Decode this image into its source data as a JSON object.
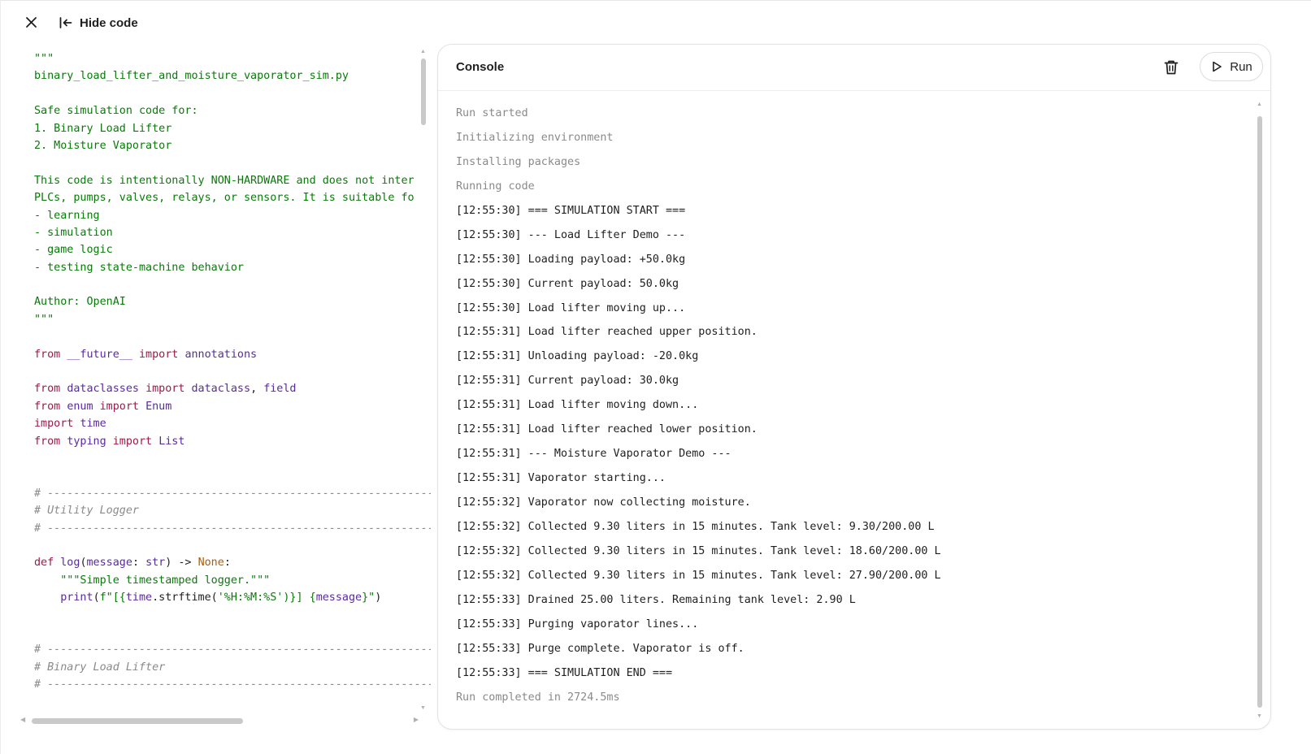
{
  "toolbar": {
    "hide_code_label": "Hide code"
  },
  "code": {
    "lines": [
      [
        {
          "t": "\"\"\"",
          "c": "str"
        }
      ],
      [
        {
          "t": "binary_load_lifter_and_moisture_vaporator_sim.py",
          "c": "str"
        }
      ],
      [],
      [
        {
          "t": "Safe simulation code for:",
          "c": "str"
        }
      ],
      [
        {
          "t": "1. Binary Load Lifter",
          "c": "str"
        }
      ],
      [
        {
          "t": "2. Moisture Vaporator",
          "c": "str"
        }
      ],
      [],
      [
        {
          "t": "This code is intentionally NON-HARDWARE and does not inter",
          "c": "str"
        }
      ],
      [
        {
          "t": "PLCs, pumps, valves, relays, or sensors. It is suitable fo",
          "c": "str"
        }
      ],
      [
        {
          "t": "- learning",
          "c": "str"
        }
      ],
      [
        {
          "t": "- simulation",
          "c": "str"
        }
      ],
      [
        {
          "t": "- game logic",
          "c": "str"
        }
      ],
      [
        {
          "t": "- testing state-machine behavior",
          "c": "str"
        }
      ],
      [],
      [
        {
          "t": "Author: OpenAI",
          "c": "str"
        }
      ],
      [
        {
          "t": "\"\"\"",
          "c": "str"
        }
      ],
      [],
      [
        {
          "t": "from",
          "c": "kw"
        },
        {
          "t": " ",
          "c": "plain"
        },
        {
          "t": "__future__",
          "c": "name"
        },
        {
          "t": " ",
          "c": "plain"
        },
        {
          "t": "import",
          "c": "kw"
        },
        {
          "t": " ",
          "c": "plain"
        },
        {
          "t": "annotations",
          "c": "name"
        }
      ],
      [],
      [
        {
          "t": "from",
          "c": "kw"
        },
        {
          "t": " ",
          "c": "plain"
        },
        {
          "t": "dataclasses",
          "c": "name"
        },
        {
          "t": " ",
          "c": "plain"
        },
        {
          "t": "import",
          "c": "kw"
        },
        {
          "t": " ",
          "c": "plain"
        },
        {
          "t": "dataclass",
          "c": "name"
        },
        {
          "t": ", ",
          "c": "plain"
        },
        {
          "t": "field",
          "c": "name"
        }
      ],
      [
        {
          "t": "from",
          "c": "kw"
        },
        {
          "t": " ",
          "c": "plain"
        },
        {
          "t": "enum",
          "c": "name"
        },
        {
          "t": " ",
          "c": "plain"
        },
        {
          "t": "import",
          "c": "kw"
        },
        {
          "t": " ",
          "c": "plain"
        },
        {
          "t": "Enum",
          "c": "name"
        }
      ],
      [
        {
          "t": "import",
          "c": "kw"
        },
        {
          "t": " ",
          "c": "plain"
        },
        {
          "t": "time",
          "c": "name"
        }
      ],
      [
        {
          "t": "from",
          "c": "kw"
        },
        {
          "t": " ",
          "c": "plain"
        },
        {
          "t": "typing",
          "c": "name"
        },
        {
          "t": " ",
          "c": "plain"
        },
        {
          "t": "import",
          "c": "kw"
        },
        {
          "t": " ",
          "c": "plain"
        },
        {
          "t": "List",
          "c": "name"
        }
      ],
      [],
      [],
      [
        {
          "t": "# -------------------------------------------------------------",
          "c": "cmt"
        }
      ],
      [
        {
          "t": "# Utility Logger",
          "c": "cmt"
        }
      ],
      [
        {
          "t": "# -------------------------------------------------------------",
          "c": "cmt"
        }
      ],
      [],
      [
        {
          "t": "def",
          "c": "kw"
        },
        {
          "t": " ",
          "c": "plain"
        },
        {
          "t": "log",
          "c": "name"
        },
        {
          "t": "(",
          "c": "plain"
        },
        {
          "t": "message",
          "c": "name"
        },
        {
          "t": ": ",
          "c": "plain"
        },
        {
          "t": "str",
          "c": "name"
        },
        {
          "t": ") -> ",
          "c": "plain"
        },
        {
          "t": "None",
          "c": "none"
        },
        {
          "t": ":",
          "c": "plain"
        }
      ],
      [
        {
          "t": "    ",
          "c": "plain"
        },
        {
          "t": "\"\"\"Simple timestamped logger.\"\"\"",
          "c": "str"
        }
      ],
      [
        {
          "t": "    ",
          "c": "plain"
        },
        {
          "t": "print",
          "c": "name"
        },
        {
          "t": "(",
          "c": "plain"
        },
        {
          "t": "f\"[{",
          "c": "str"
        },
        {
          "t": "time",
          "c": "name"
        },
        {
          "t": ".strftime(",
          "c": "plain"
        },
        {
          "t": "'%H:%M:%S'",
          "c": "str"
        },
        {
          "t": ")}] {",
          "c": "str"
        },
        {
          "t": "message",
          "c": "name"
        },
        {
          "t": "}\"",
          "c": "str"
        },
        {
          "t": ")",
          "c": "plain"
        }
      ],
      [],
      [],
      [
        {
          "t": "# -------------------------------------------------------------",
          "c": "cmt"
        }
      ],
      [
        {
          "t": "# Binary Load Lifter",
          "c": "cmt"
        }
      ],
      [
        {
          "t": "# -------------------------------------------------------------",
          "c": "cmt"
        }
      ]
    ]
  },
  "console": {
    "title": "Console",
    "run_label": "Run",
    "lines": [
      {
        "text": "Run started",
        "status": true
      },
      {
        "text": "Initializing environment",
        "status": true
      },
      {
        "text": "Installing packages",
        "status": true
      },
      {
        "text": "Running code",
        "status": true
      },
      {
        "text": "[12:55:30] === SIMULATION START ==="
      },
      {
        "text": "[12:55:30] --- Load Lifter Demo ---"
      },
      {
        "text": "[12:55:30] Loading payload: +50.0kg"
      },
      {
        "text": "[12:55:30] Current payload: 50.0kg"
      },
      {
        "text": "[12:55:30] Load lifter moving up..."
      },
      {
        "text": "[12:55:31] Load lifter reached upper position."
      },
      {
        "text": "[12:55:31] Unloading payload: -20.0kg"
      },
      {
        "text": "[12:55:31] Current payload: 30.0kg"
      },
      {
        "text": "[12:55:31] Load lifter moving down..."
      },
      {
        "text": "[12:55:31] Load lifter reached lower position."
      },
      {
        "text": "[12:55:31] --- Moisture Vaporator Demo ---"
      },
      {
        "text": "[12:55:31] Vaporator starting..."
      },
      {
        "text": "[12:55:32] Vaporator now collecting moisture."
      },
      {
        "text": "[12:55:32] Collected 9.30 liters in 15 minutes. Tank level: 9.30/200.00 L"
      },
      {
        "text": "[12:55:32] Collected 9.30 liters in 15 minutes. Tank level: 18.60/200.00 L"
      },
      {
        "text": "[12:55:32] Collected 9.30 liters in 15 minutes. Tank level: 27.90/200.00 L"
      },
      {
        "text": "[12:55:33] Drained 25.00 liters. Remaining tank level: 2.90 L"
      },
      {
        "text": "[12:55:33] Purging vaporator lines..."
      },
      {
        "text": "[12:55:33] Purge complete. Vaporator is off."
      },
      {
        "text": "[12:55:33] === SIMULATION END ==="
      },
      {
        "text": "Run completed in 2724.5ms",
        "status": true
      }
    ]
  },
  "icons": {
    "close": "close-icon",
    "hide_code": "collapse-left-icon",
    "trash": "trash-icon",
    "run": "play-icon"
  },
  "colors": {
    "string": "#0a7a0a",
    "keyword": "#a0194a",
    "name": "#5a2aa0",
    "comment": "#8a8a8a",
    "status_text": "#8a8a8a"
  }
}
